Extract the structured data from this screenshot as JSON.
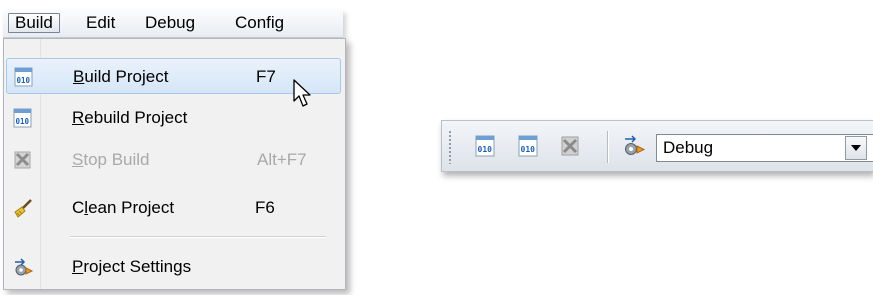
{
  "menubar": {
    "items": [
      {
        "label": "Build"
      },
      {
        "label": "Edit"
      },
      {
        "label": "Debug"
      },
      {
        "label": "Config"
      }
    ]
  },
  "build_menu": {
    "items": [
      {
        "pre": "",
        "accel": "B",
        "post": "uild Project",
        "shortcut": "F7",
        "icon": "build-project-icon",
        "enabled": true
      },
      {
        "pre": "",
        "accel": "R",
        "post": "ebuild Project",
        "shortcut": "",
        "icon": "rebuild-project-icon",
        "enabled": true
      },
      {
        "pre": "",
        "accel": "S",
        "post": "top Build",
        "shortcut": "Alt+F7",
        "icon": "stop-build-icon",
        "enabled": false
      },
      {
        "pre": "C",
        "accel": "l",
        "post": "ean Project",
        "shortcut": "F6",
        "icon": "broom-icon",
        "enabled": true
      },
      {
        "pre": "",
        "accel": "P",
        "post": "roject Settings",
        "shortcut": "",
        "icon": "project-settings-icon",
        "enabled": true
      }
    ]
  },
  "toolbar": {
    "configuration": "Debug"
  },
  "colors": {
    "highlight": "#d5e6f8",
    "disabled_text": "#a9a9a9",
    "icon_blue": "#1f5fae"
  }
}
